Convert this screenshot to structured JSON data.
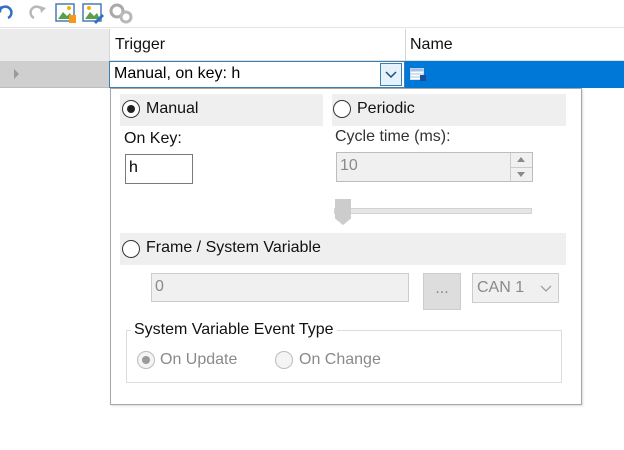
{
  "toolbar": {
    "icons": [
      "undo-icon",
      "redo-icon",
      "image-add-icon",
      "image-edit-icon",
      "gears-icon"
    ]
  },
  "grid": {
    "columns": [
      {
        "label": "Trigger"
      },
      {
        "label": "Name"
      }
    ],
    "row": {
      "trigger_value": "Manual, on key: h"
    }
  },
  "panel": {
    "manual": {
      "label": "Manual",
      "checked": true
    },
    "periodic": {
      "label": "Periodic",
      "checked": false
    },
    "on_key": {
      "label": "On Key:",
      "value": "h"
    },
    "cycle_time": {
      "label": "Cycle time (ms):",
      "value": "10"
    },
    "frame_var": {
      "label": "Frame / System Variable",
      "checked": false
    },
    "frame_input": {
      "value": "0"
    },
    "browse_label": "...",
    "channel": {
      "value": "CAN 1"
    },
    "event_type": {
      "title": "System Variable Event Type",
      "on_update": "On Update",
      "on_change": "On Change"
    }
  },
  "colors": {
    "selection": "#0078d7",
    "focus_border": "#3c7fb1",
    "disabled_text": "#8a8a8a"
  }
}
